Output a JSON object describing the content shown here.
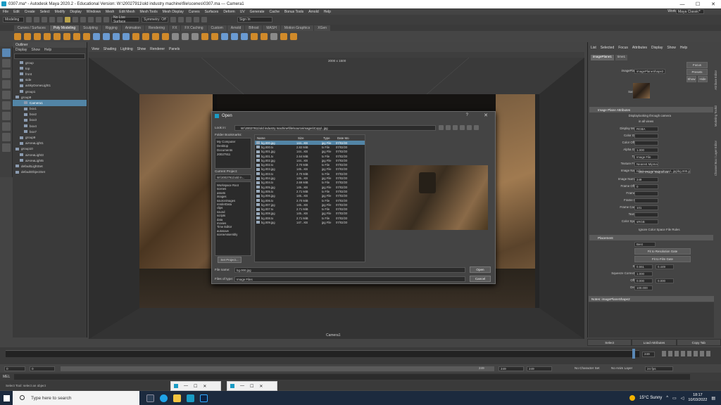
{
  "window": {
    "title": "0307.ma* - Autodesk Maya 2020.2 - Educational Version: W:\\20027911\\old industry machine\\file\\scenes\\0307.ma  ---  Camera1",
    "min": "—",
    "max": "☐",
    "close": "✕"
  },
  "menubar": {
    "items": [
      "File",
      "Edit",
      "Create",
      "Select",
      "Modify",
      "Display",
      "Windows",
      "Mesh",
      "Edit Mesh",
      "Mesh Tools",
      "Mesh Display",
      "Curves",
      "Surfaces",
      "Deform",
      "UV",
      "Generate",
      "Cache",
      "Bonus Tools",
      "Arnold",
      "Help"
    ],
    "workspace_label": "Workspace :",
    "workspace_value": "Maya Classic*"
  },
  "status": {
    "mode": "Modeling",
    "live_surface": "No Live Surface",
    "symmetry": "Symmetry: Off",
    "signin": "Sign In"
  },
  "shelf": {
    "tabs": [
      "Curves / Surfaces",
      "Poly Modeling",
      "Sculpting",
      "Rigging",
      "Animation",
      "Rendering",
      "FX",
      "FX Caching",
      "Custom",
      "Arnold",
      "Bifrost",
      "MASH",
      "Motion Graphics",
      "XGen"
    ],
    "active": "Poly Modeling"
  },
  "outliner": {
    "title": "Outliner",
    "menu": [
      "Display",
      "Show",
      "Help"
    ],
    "items": [
      {
        "label": "group",
        "indent": 1,
        "sel": false
      },
      {
        "label": "top",
        "indent": 1,
        "sel": false
      },
      {
        "label": "front",
        "indent": 1,
        "sel": false
      },
      {
        "label": "side",
        "indent": 1,
        "sel": false
      },
      {
        "label": "aiSkyDomeLight1",
        "indent": 1,
        "sel": false
      },
      {
        "label": "group1",
        "indent": 1,
        "sel": false
      },
      {
        "label": "group9",
        "indent": 0,
        "sel": false
      },
      {
        "label": "Camera1",
        "indent": 2,
        "sel": true
      },
      {
        "label": "box1",
        "indent": 2,
        "sel": false
      },
      {
        "label": "box2",
        "indent": 2,
        "sel": false
      },
      {
        "label": "box3",
        "indent": 2,
        "sel": false
      },
      {
        "label": "box4",
        "indent": 2,
        "sel": false
      },
      {
        "label": "box7",
        "indent": 2,
        "sel": false
      },
      {
        "label": "group9",
        "indent": 1,
        "sel": false
      },
      {
        "label": "aiAreaLight1",
        "indent": 1,
        "sel": false
      },
      {
        "label": "group10",
        "indent": 0,
        "sel": false
      },
      {
        "label": "aiAreaLight3",
        "indent": 1,
        "sel": false
      },
      {
        "label": "aiAreaLight5",
        "indent": 1,
        "sel": false
      },
      {
        "label": "defaultLightSet",
        "indent": 0,
        "sel": false
      },
      {
        "label": "defaultObjectSet",
        "indent": 0,
        "sel": false
      }
    ]
  },
  "viewport": {
    "menu": [
      "View",
      "Shading",
      "Lighting",
      "Show",
      "Renderer",
      "Panels"
    ],
    "resolution": "2000 x 1500",
    "camera": "Camera1",
    "field1": "0.00",
    "field2": "1.00"
  },
  "dialog": {
    "title": "Open",
    "help": "?",
    "close": "✕",
    "look_in_label": "Look in:",
    "look_in_value": "W:\\20027911\\old industry machine\\file\\sourceimages\\Copy\\..jpg",
    "folder_bookmarks_label": "Folder Bookmarks:",
    "bookmarks": [
      "My Computer",
      "Desktop",
      "Documents",
      "20027911"
    ],
    "current_project_label": "Current Project:",
    "current_project": "W:\\20027911\\old in...",
    "folders": [
      "Workspace Root",
      "scenes",
      "assets",
      "images",
      "sourceimages",
      "renderData",
      "clips",
      "sound",
      "scripts",
      "data",
      "movies",
      "Time Editor",
      "autosave",
      "sceneAssembly"
    ],
    "set_project": "Set Project...",
    "columns": [
      "Name",
      "Size",
      "Type",
      "Date Mo"
    ],
    "files": [
      {
        "name": "bg.000.jpg",
        "size": "144...KB",
        "type": "jpg File",
        "date": "07/02/20",
        "sel": true
      },
      {
        "name": "bg.000.tx",
        "size": "2.82 MiB",
        "type": "tx File",
        "date": "07/02/20",
        "sel": false
      },
      {
        "name": "bg.001.jpg",
        "size": "144...KB",
        "type": "jpg File",
        "date": "07/02/20",
        "sel": false
      },
      {
        "name": "bg.001.tx",
        "size": "2.64 MiB",
        "type": "tx File",
        "date": "07/02/20",
        "sel": false
      },
      {
        "name": "bg.002.jpg",
        "size": "144...KB",
        "type": "jpg File",
        "date": "07/02/20",
        "sel": false
      },
      {
        "name": "bg.002.tx",
        "size": "2.70 MiB",
        "type": "tx File",
        "date": "07/02/20",
        "sel": false
      },
      {
        "name": "bg.003.jpg",
        "size": "145...KB",
        "type": "jpg File",
        "date": "07/02/20",
        "sel": false
      },
      {
        "name": "bg.003.tx",
        "size": "2.70 MiB",
        "type": "tx File",
        "date": "07/02/20",
        "sel": false
      },
      {
        "name": "bg.004.jpg",
        "size": "145...KB",
        "type": "jpg File",
        "date": "07/02/20",
        "sel": false
      },
      {
        "name": "bg.004.tx",
        "size": "2.69 MiB",
        "type": "tx File",
        "date": "07/02/20",
        "sel": false
      },
      {
        "name": "bg.005.jpg",
        "size": "145...KB",
        "type": "jpg File",
        "date": "07/02/20",
        "sel": false
      },
      {
        "name": "bg.005.tx",
        "size": "2.71 MiB",
        "type": "tx File",
        "date": "07/02/20",
        "sel": false
      },
      {
        "name": "bg.006.jpg",
        "size": "145...KB",
        "type": "jpg File",
        "date": "07/02/20",
        "sel": false
      },
      {
        "name": "bg.006.tx",
        "size": "2.70 MiB",
        "type": "tx File",
        "date": "07/02/20",
        "sel": false
      },
      {
        "name": "bg.007.jpg",
        "size": "145...KB",
        "type": "jpg File",
        "date": "07/02/20",
        "sel": false
      },
      {
        "name": "bg.007.tx",
        "size": "2.71 MiB",
        "type": "tx File",
        "date": "07/02/20",
        "sel": false
      },
      {
        "name": "bg.008.jpg",
        "size": "145...KB",
        "type": "jpg File",
        "date": "07/02/20",
        "sel": false
      },
      {
        "name": "bg.008.tx",
        "size": "2.71 MiB",
        "type": "tx File",
        "date": "07/02/20",
        "sel": false
      },
      {
        "name": "bg.009.jpg",
        "size": "147...KB",
        "type": "jpg File",
        "date": "07/02/20",
        "sel": false
      }
    ],
    "file_name_label": "File name:",
    "file_name": "bg.000.jpg",
    "file_type_label": "Files of type:",
    "file_type": "Image Files",
    "open": "Open",
    "cancel": "Cancel"
  },
  "attr": {
    "menu": [
      "List",
      "Selected",
      "Focus",
      "Attributes",
      "Display",
      "Show",
      "Help"
    ],
    "tabs": [
      "imagePlane1",
      "time1"
    ],
    "imageplane_label": "imagePlane:",
    "imageplane_value": "imagePlaneShape2",
    "focus": "Focus",
    "presets": "Presets",
    "show": "Show",
    "hide": "Hide",
    "sample": "Sample",
    "section1": "Image Plane Attributes",
    "display_label": "Display",
    "looking_through": "looking through camera",
    "in_all_views": "in all views",
    "rows": [
      {
        "label": "Display Mode",
        "value": "RGBA"
      },
      {
        "label": "Color Gain",
        "value": ""
      },
      {
        "label": "Color Offset",
        "value": ""
      },
      {
        "label": "Alpha Gain",
        "value": "1.000"
      },
      {
        "label": "Type",
        "value": "Image File"
      },
      {
        "label": "Texture Filter",
        "value": "Nearest Mipmap"
      },
      {
        "label": "Image Name",
        "value": "hfile/sourceimages/Copy\\..jpg\\bg.000.jpg"
      }
    ],
    "use_image_sequence": "Use Image Sequence",
    "rows2": [
      {
        "label": "Image Number",
        "value": "249"
      },
      {
        "label": "Frame Offset",
        "value": "0"
      },
      {
        "label": "Frame In",
        "value": ""
      },
      {
        "label": "Frame Out",
        "value": ""
      },
      {
        "label": "Frame Cache",
        "value": "101"
      },
      {
        "label": "Texture",
        "value": ""
      },
      {
        "label": "Color Space",
        "value": "sRGB"
      }
    ],
    "ignore_cs": "Ignore Color Space File Rules",
    "section2": "Placement",
    "fit_label": "Fit",
    "fit_value": "Best",
    "fit_res": "Fit to Resolution Gate",
    "fit_film": "Fit to Film Gate",
    "size_label": "Size",
    "size1": "0.551",
    "size2": "0.449",
    "squeeze_label": "Squeeze Correction",
    "squeeze": "1.000",
    "offset_label": "Offset",
    "offset1": "0.000",
    "offset2": "0.000",
    "depth_label": "Depth",
    "depth": "100.000",
    "notes": "Notes: imagePlaneShape2",
    "select": "Select",
    "load_attrs": "Load Attributes",
    "copy_tab": "Copy Tab",
    "side_tabs": [
      "Attribute Editor",
      "Modeling Toolkit",
      "Channel Box / Layer Editor"
    ]
  },
  "timeline": {
    "current": "249",
    "range_start": "0",
    "range_start2": "0",
    "range_end": "249",
    "range_end2": "249",
    "range_end3": "249",
    "character_set": "No Character Set",
    "anim_layer": "No Anim Layer",
    "fps": "24 fps"
  },
  "mel": {
    "label": "MEL"
  },
  "help": {
    "text": "Select Tool: select an object"
  },
  "taskbar": {
    "search": "Type here to search",
    "weather": "15°C  Sunny",
    "time": "18:17",
    "date": "10/03/2022"
  },
  "colors": {
    "selection": "#5285a6",
    "maya_blue": "#1a9bc4",
    "taskbar": "#1c2a3e"
  }
}
